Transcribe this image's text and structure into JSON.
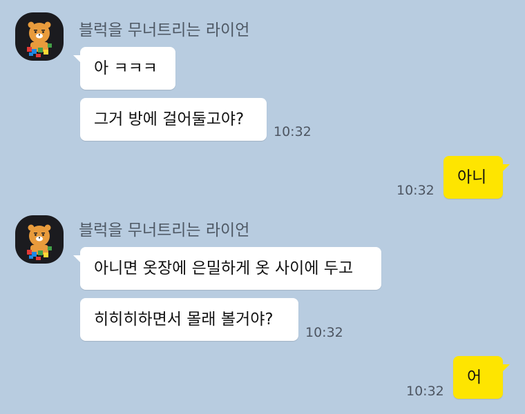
{
  "chat": {
    "messages": [
      {
        "sender": "블럭을 무너트리는 라이언",
        "avatar_icon": "ryan-profile-icon",
        "bubbles": [
          "아 ㅋㅋㅋ",
          "그거 방에 걸어둘고야?"
        ],
        "time": "10:32"
      },
      {
        "mine": true,
        "bubbles": [
          "아니"
        ],
        "time": "10:32"
      },
      {
        "sender": "블럭을 무너트리는 라이언",
        "avatar_icon": "ryan-profile-icon",
        "bubbles": [
          "아니면 옷장에 은밀하게 옷 사이에 두고",
          "히히히하면서 몰래 볼거야?"
        ],
        "time": "10:32"
      },
      {
        "mine": true,
        "bubbles": [
          "어"
        ],
        "time": "10:32"
      }
    ]
  },
  "colors": {
    "background": "#b8cce0",
    "incoming_bubble": "#ffffff",
    "outgoing_bubble": "#fee500",
    "avatar_bg": "#1b1b1f",
    "ryan": "#e89b3c"
  }
}
